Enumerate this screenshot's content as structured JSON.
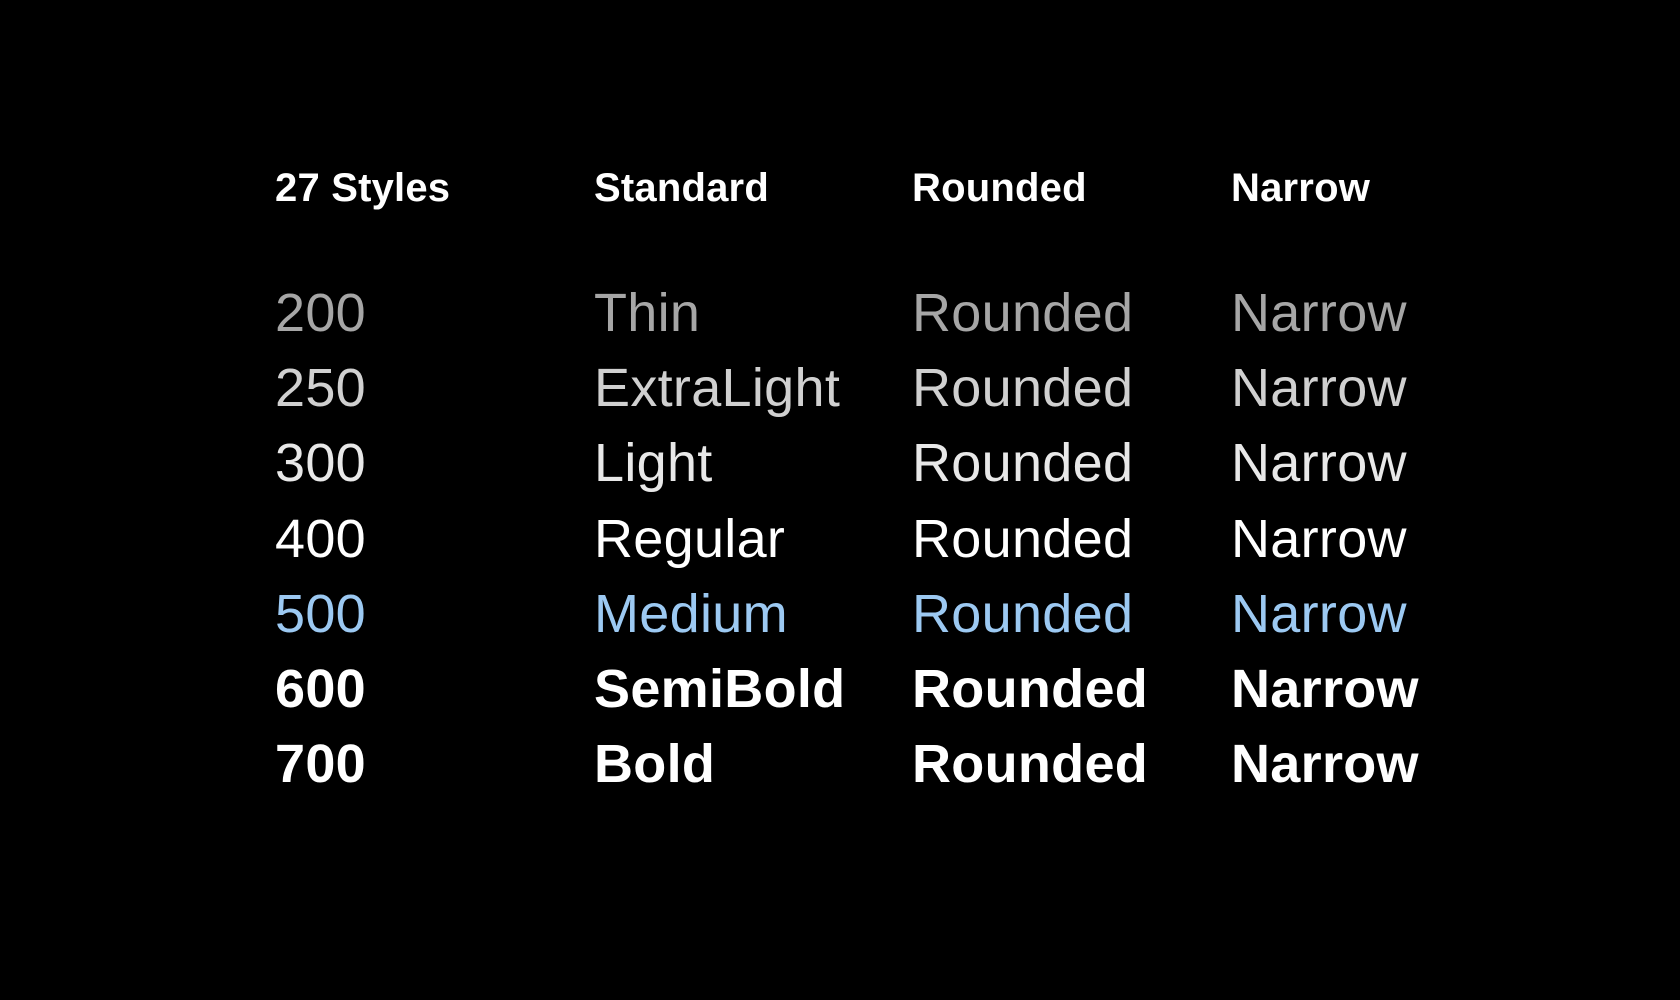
{
  "colors": {
    "background": "#000000",
    "text": "#ffffff",
    "accent": "#9cc9f2"
  },
  "header": {
    "count_label": "27 Styles",
    "standard_label": "Standard",
    "rounded_label": "Rounded",
    "narrow_label": "Narrow"
  },
  "styles": [
    {
      "weight": "200",
      "standard": "Thin",
      "rounded": "Rounded",
      "narrow": "Narrow"
    },
    {
      "weight": "250",
      "standard": "ExtraLight",
      "rounded": "Rounded",
      "narrow": "Narrow"
    },
    {
      "weight": "300",
      "standard": "Light",
      "rounded": "Rounded",
      "narrow": "Narrow"
    },
    {
      "weight": "400",
      "standard": "Regular",
      "rounded": "Rounded",
      "narrow": "Narrow"
    },
    {
      "weight": "500",
      "standard": "Medium",
      "rounded": "Rounded",
      "narrow": "Narrow",
      "highlight_color": "#9cc9f2"
    },
    {
      "weight": "600",
      "standard": "SemiBold",
      "rounded": "Rounded",
      "narrow": "Narrow"
    },
    {
      "weight": "700",
      "standard": "Bold",
      "rounded": "Rounded",
      "narrow": "Narrow"
    }
  ]
}
